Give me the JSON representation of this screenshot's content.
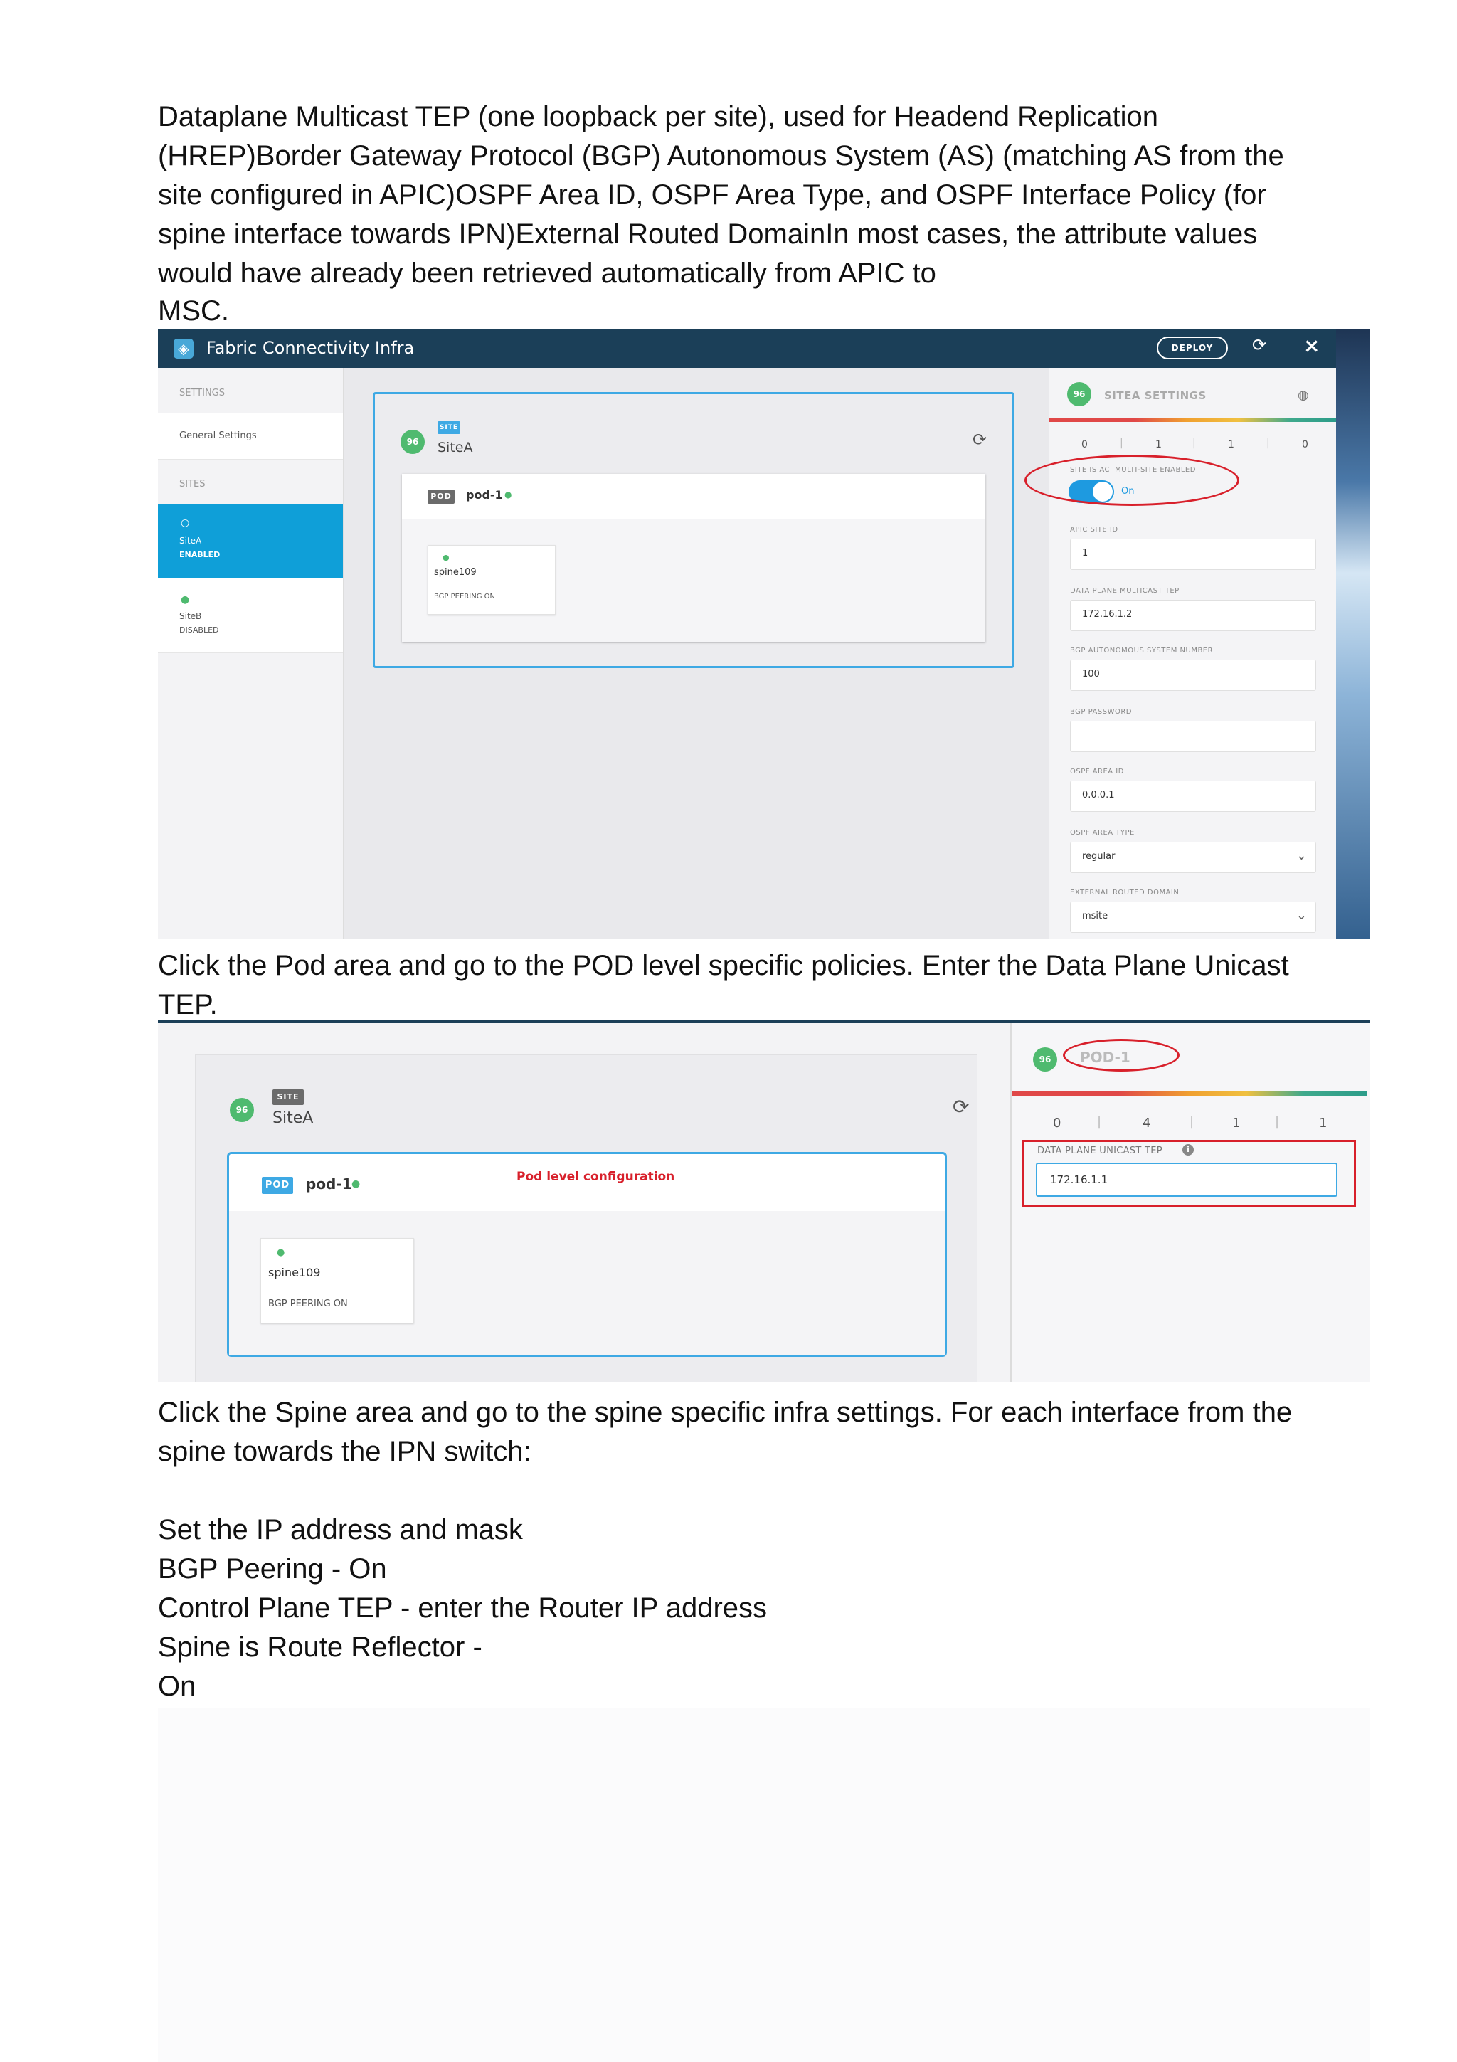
{
  "intro_lines": [
    "Dataplane Multicast TEP (one loopback per site), used for Headend Replication",
    "(HREP)Border Gateway Protocol (BGP) Autonomous System (AS) (matching AS from the",
    "site configured in APIC)OSPF Area ID, OSPF Area Type, and OSPF Interface Policy (for",
    "spine interface towards IPN)External Routed DomainIn most cases, the attribute values",
    "would have already been retrieved automatically from APIC to",
    "MSC."
  ],
  "shot1": {
    "app_title": "Fabric Connectivity Infra",
    "deploy": "DEPLOY",
    "sidebar": {
      "settings_header": "SETTINGS",
      "general_settings": "General Settings",
      "sites_header": "SITES",
      "sites": [
        {
          "name": "SiteA",
          "status": "ENABLED"
        },
        {
          "name": "SiteB",
          "status": "DISABLED"
        }
      ]
    },
    "site_card": {
      "badge": "96",
      "tag": "SITE",
      "name": "SiteA",
      "pod_tag": "POD",
      "pod_name": "pod-1",
      "spine_name": "spine109",
      "spine_status": "BGP PEERING ON"
    },
    "settings_panel": {
      "badge": "96",
      "title": "SITEA SETTINGS",
      "counts": [
        "0",
        "1",
        "1",
        "0"
      ],
      "multisite_label": "SITE IS ACI MULTI-SITE ENABLED",
      "toggle_state": "On",
      "fields": [
        {
          "label": "APIC SITE ID",
          "value": "1"
        },
        {
          "label": "DATA PLANE MULTICAST TEP",
          "value": "172.16.1.2"
        },
        {
          "label": "BGP AUTONOMOUS SYSTEM NUMBER",
          "value": "100"
        },
        {
          "label": "BGP PASSWORD",
          "value": ""
        },
        {
          "label": "OSPF AREA ID",
          "value": "0.0.0.1"
        },
        {
          "label": "OSPF AREA TYPE",
          "value": "regular"
        },
        {
          "label": "EXTERNAL ROUTED DOMAIN",
          "value": "msite"
        }
      ]
    }
  },
  "para2_lines": [
    "Click the Pod area and go to the POD level specific policies. Enter the Data Plane Unicast",
    "TEP."
  ],
  "shot2": {
    "site_card": {
      "badge": "96",
      "tag": "SITE",
      "name": "SiteA",
      "pod_tag": "POD",
      "pod_name": "pod-1",
      "annotation": "Pod level configuration",
      "spine_name": "spine109",
      "spine_status": "BGP PEERING ON"
    },
    "pod_panel": {
      "badge": "96",
      "title": "POD-1",
      "counts": [
        "0",
        "4",
        "1",
        "1"
      ],
      "field_label": "DATA PLANE UNICAST TEP",
      "field_value": "172.16.1.1"
    }
  },
  "para3_lines": [
    "Click the Spine area and go to the spine specific infra settings. For each interface from the",
    "spine towards the IPN switch:"
  ],
  "list_lines": [
    "Set the IP address and mask",
    "BGP Peering - On",
    "Control Plane TEP - enter the Router IP address",
    "Spine is Route Reflector -",
    "On"
  ],
  "colors": {
    "titlebar": "#1b3f58",
    "accent_blue": "#3ea9e4",
    "badge_green": "#4fba6f",
    "annotation_red": "#d8202b"
  }
}
